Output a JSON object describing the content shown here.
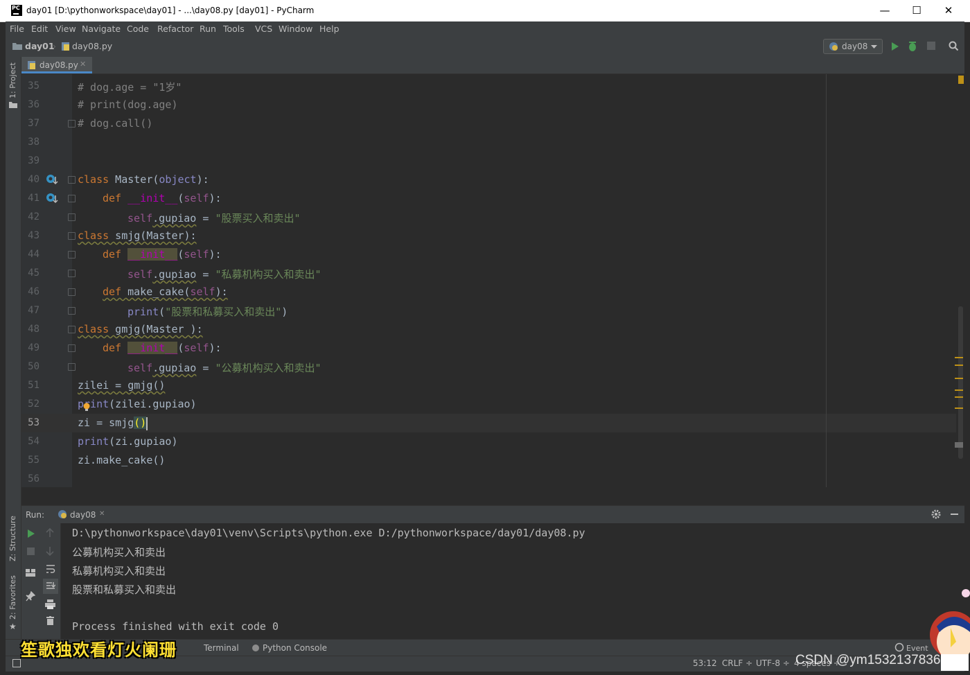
{
  "window": {
    "title": "day01 [D:\\pythonworkspace\\day01] - ...\\day08.py [day01] - PyCharm",
    "minimize": "—",
    "maximize": "☐",
    "close": "✕"
  },
  "menu": [
    "File",
    "Edit",
    "View",
    "Navigate",
    "Code",
    "Refactor",
    "Run",
    "Tools",
    "VCS",
    "Window",
    "Help"
  ],
  "breadcrumb": {
    "project": "day01",
    "file": "day08.py"
  },
  "run_config": "day08",
  "tabs": [
    {
      "label": "day08.py"
    }
  ],
  "side_tools": {
    "project": "1: Project",
    "structure": "Z: Structure",
    "favorites": "2: Favorites"
  },
  "editor": {
    "cursor": "53:12",
    "line_numbers": [
      "35",
      "36",
      "37",
      "38",
      "39",
      "40",
      "41",
      "42",
      "43",
      "44",
      "45",
      "46",
      "47",
      "48",
      "49",
      "50",
      "51",
      "52",
      "53",
      "54",
      "55",
      "56"
    ],
    "lines": {
      "l35": "# dog.age = \"1岁\"",
      "l36": "# print(dog.age)",
      "l37": "# dog.call()",
      "l40_kw": "class",
      "l40_name": " Master(",
      "l40_obj": "object",
      "l40_end": "):",
      "l41_kw": "def",
      "l41_fn": "__init__",
      "l41_self": "self",
      "l42_self": "self",
      "l42_attr": ".gupiao",
      "l42_str": "\"股票买入和卖出\"",
      "l43_kw": "class",
      "l43_name": " smjg(Master):",
      "l44_kw": "def",
      "l44_fn": "__init__",
      "l44_self": "self",
      "l45_self": "self",
      "l45_attr": ".gupiao",
      "l45_str": "\"私募机构买入和卖出\"",
      "l46_kw": "def",
      "l46_name": " make_cake(",
      "l46_self": "self",
      "l46_end": "):",
      "l47_fn": "print",
      "l47_str": "\"股票和私募买入和卖出\"",
      "l48_kw": "class",
      "l48_name": " gmjg(Master ):",
      "l49_kw": "def",
      "l49_fn": "__init__",
      "l49_self": "self",
      "l50_self": "self",
      "l50_attr": ".gupiao",
      "l50_str": "\"公募机构买入和卖出\"",
      "l51": "zilei = gmjg()",
      "l52_fn": "print",
      "l52_rest": "(zilei.gupiao)",
      "l53_a": "zi = smjg",
      "l53_b": "()",
      "l54_fn": "print",
      "l54_rest": "(zi.gupiao)",
      "l55": "zi.make_cake()"
    }
  },
  "run_panel": {
    "label": "Run:",
    "tab": "day08",
    "output": [
      "D:\\pythonworkspace\\day01\\venv\\Scripts\\python.exe D:/pythonworkspace/day01/day08.py",
      "公募机构买入和卖出",
      "私募机构买入和卖出",
      "股票和私募买入和卖出",
      "",
      "Process finished with exit code 0"
    ]
  },
  "bottom_tabs": {
    "terminal": "Terminal",
    "python_console": "Python Console",
    "event_log": "Event"
  },
  "status": {
    "position": "53:12",
    "line_sep": "CRLF ÷",
    "encoding": "UTF-8 ÷",
    "indent": "4 spaces ÷"
  },
  "overlays": {
    "caption": "笙歌独欢看灯火阑珊",
    "watermark": "CSDN @ym15321378362"
  }
}
